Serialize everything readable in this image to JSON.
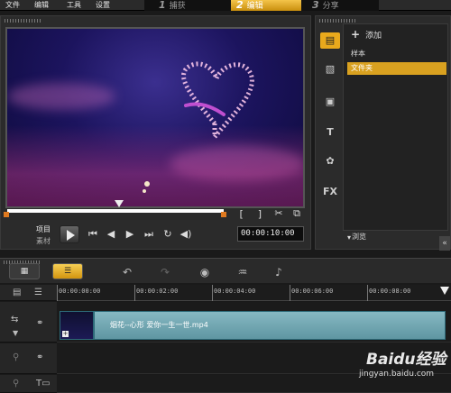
{
  "menu": [
    "文件",
    "编辑",
    "工具",
    "设置"
  ],
  "steps": [
    {
      "num": "1",
      "label": "捕获",
      "active": false
    },
    {
      "num": "2",
      "label": "编辑",
      "active": true
    },
    {
      "num": "3",
      "label": "分享",
      "active": false
    }
  ],
  "player": {
    "mode_project": "项目",
    "mode_clip": "素材",
    "timecode": "00:00:10:00",
    "bracket_in": "[",
    "bracket_out": "]"
  },
  "library": {
    "add_label": "添加",
    "items": [
      "样本",
      "文件夹"
    ],
    "selected_index": 1,
    "browse_label": "浏览",
    "tabs": [
      "media-icon",
      "transition-icon",
      "title-icon",
      "text-icon",
      "graphic-icon",
      "fx-icon"
    ],
    "fx_label": "FX"
  },
  "timeline": {
    "ruler_labels": [
      "00:00:00:00",
      "00:00:02:00",
      "00:00:04:00",
      "00:00:06:00",
      "00:00:08:00"
    ],
    "clip_name": "烟花--心形 爱你一生一世.mp4"
  },
  "watermark": {
    "brand": "Baidu经验",
    "url": "jingyan.baidu.com"
  },
  "colors": {
    "accent": "#e9a91c",
    "clip": "#6fa5b0"
  }
}
